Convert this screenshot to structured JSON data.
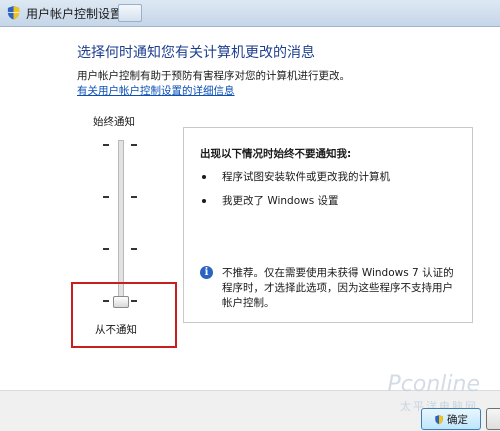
{
  "window": {
    "title": "用户帐户控制设置"
  },
  "header": {
    "heading": "选择何时通知您有关计算机更改的消息",
    "description": "用户帐户控制有助于预防有害程序对您的计算机进行更改。",
    "link": "有关用户帐户控制设置的详细信息"
  },
  "slider": {
    "top_label": "始终通知",
    "bottom_label": "从不通知",
    "levels": 4,
    "selected_level": 1
  },
  "panel": {
    "title": "出现以下情况时始终不要通知我:",
    "bullets": [
      "程序试图安装软件或更改我的计算机",
      "我更改了 Windows 设置"
    ],
    "info": "不推荐。仅在需要使用未获得 Windows 7 认证的程序时，才选择此选项，因为这些程序不支持用户帐户控制。"
  },
  "footer": {
    "ok_label": "确定",
    "watermark": "Pconline",
    "watermark_sub": "太平洋电脑网"
  },
  "colors": {
    "heading": "#1e3f8f",
    "link": "#0a4fb4",
    "highlight": "#c81e1e"
  }
}
